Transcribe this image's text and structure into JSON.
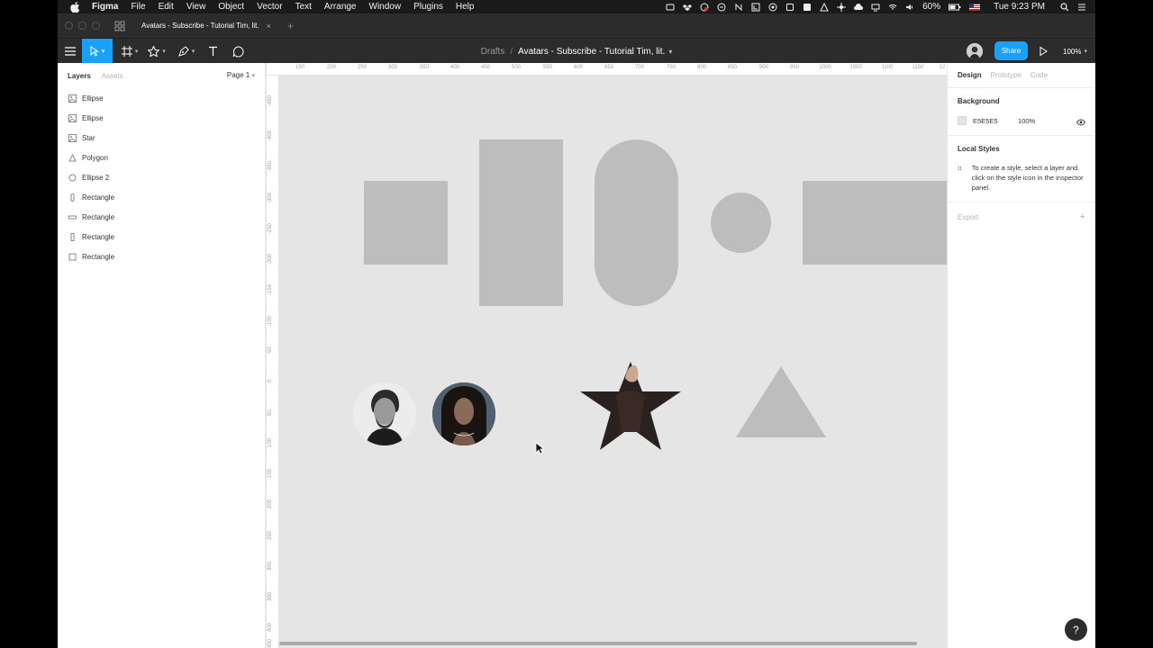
{
  "menubar": {
    "app": "Figma",
    "items": [
      "File",
      "Edit",
      "View",
      "Object",
      "Vector",
      "Text",
      "Arrange",
      "Window",
      "Plugins",
      "Help"
    ],
    "battery": "60%",
    "clock": "Tue 9:23 PM"
  },
  "tab": {
    "title": "Avatars - Subscribe - Tutorial Tim, lit.",
    "close": "×",
    "add": "+"
  },
  "toolbar": {
    "breadcrumb_root": "Drafts",
    "breadcrumb_sep": "/",
    "file_name": "Avatars - Subscribe - Tutorial Tim, lit.",
    "share_label": "Share",
    "zoom": "100%",
    "accent": "#18a0fb"
  },
  "left_panel": {
    "tab_layers": "Layers",
    "tab_assets": "Assets",
    "page": "Page 1",
    "layers": [
      {
        "name": "Ellipse",
        "icon": "image-icon"
      },
      {
        "name": "Ellipse",
        "icon": "image-icon"
      },
      {
        "name": "Star",
        "icon": "image-icon"
      },
      {
        "name": "Polygon",
        "icon": "polygon-icon"
      },
      {
        "name": "Ellipse 2",
        "icon": "ellipse-icon"
      },
      {
        "name": "Rectangle",
        "icon": "tall-rectangle-icon"
      },
      {
        "name": "Rectangle",
        "icon": "wide-rectangle-icon"
      },
      {
        "name": "Rectangle",
        "icon": "tall-rectangle-icon"
      },
      {
        "name": "Rectangle",
        "icon": "rectangle-icon"
      }
    ]
  },
  "rulers": {
    "top": [
      "150",
      "200",
      "250",
      "300",
      "350",
      "400",
      "450",
      "500",
      "550",
      "600",
      "650",
      "700",
      "750",
      "800",
      "850",
      "900",
      "950",
      "1000",
      "1050",
      "1100",
      "1150",
      "12"
    ],
    "left": [
      "-450",
      "-400",
      "-350",
      "-300",
      "-250",
      "-200",
      "-150",
      "-100",
      "-50",
      "0",
      "50",
      "100",
      "150",
      "200",
      "250",
      "300",
      "350",
      "400",
      "450"
    ]
  },
  "right_panel": {
    "tab_design": "Design",
    "tab_prototype": "Prototype",
    "tab_code": "Code",
    "background_title": "Background",
    "background_hex": "E5E5E5",
    "background_opacity": "100%",
    "local_styles_title": "Local Styles",
    "local_styles_hint": "To create a style, select a layer and click on the style icon in the inspector panel.",
    "export_title": "Export",
    "export_add": "+"
  },
  "help": "?",
  "canvas_fill": "#e5e5e5",
  "shape_fill": "#bdbdbd"
}
